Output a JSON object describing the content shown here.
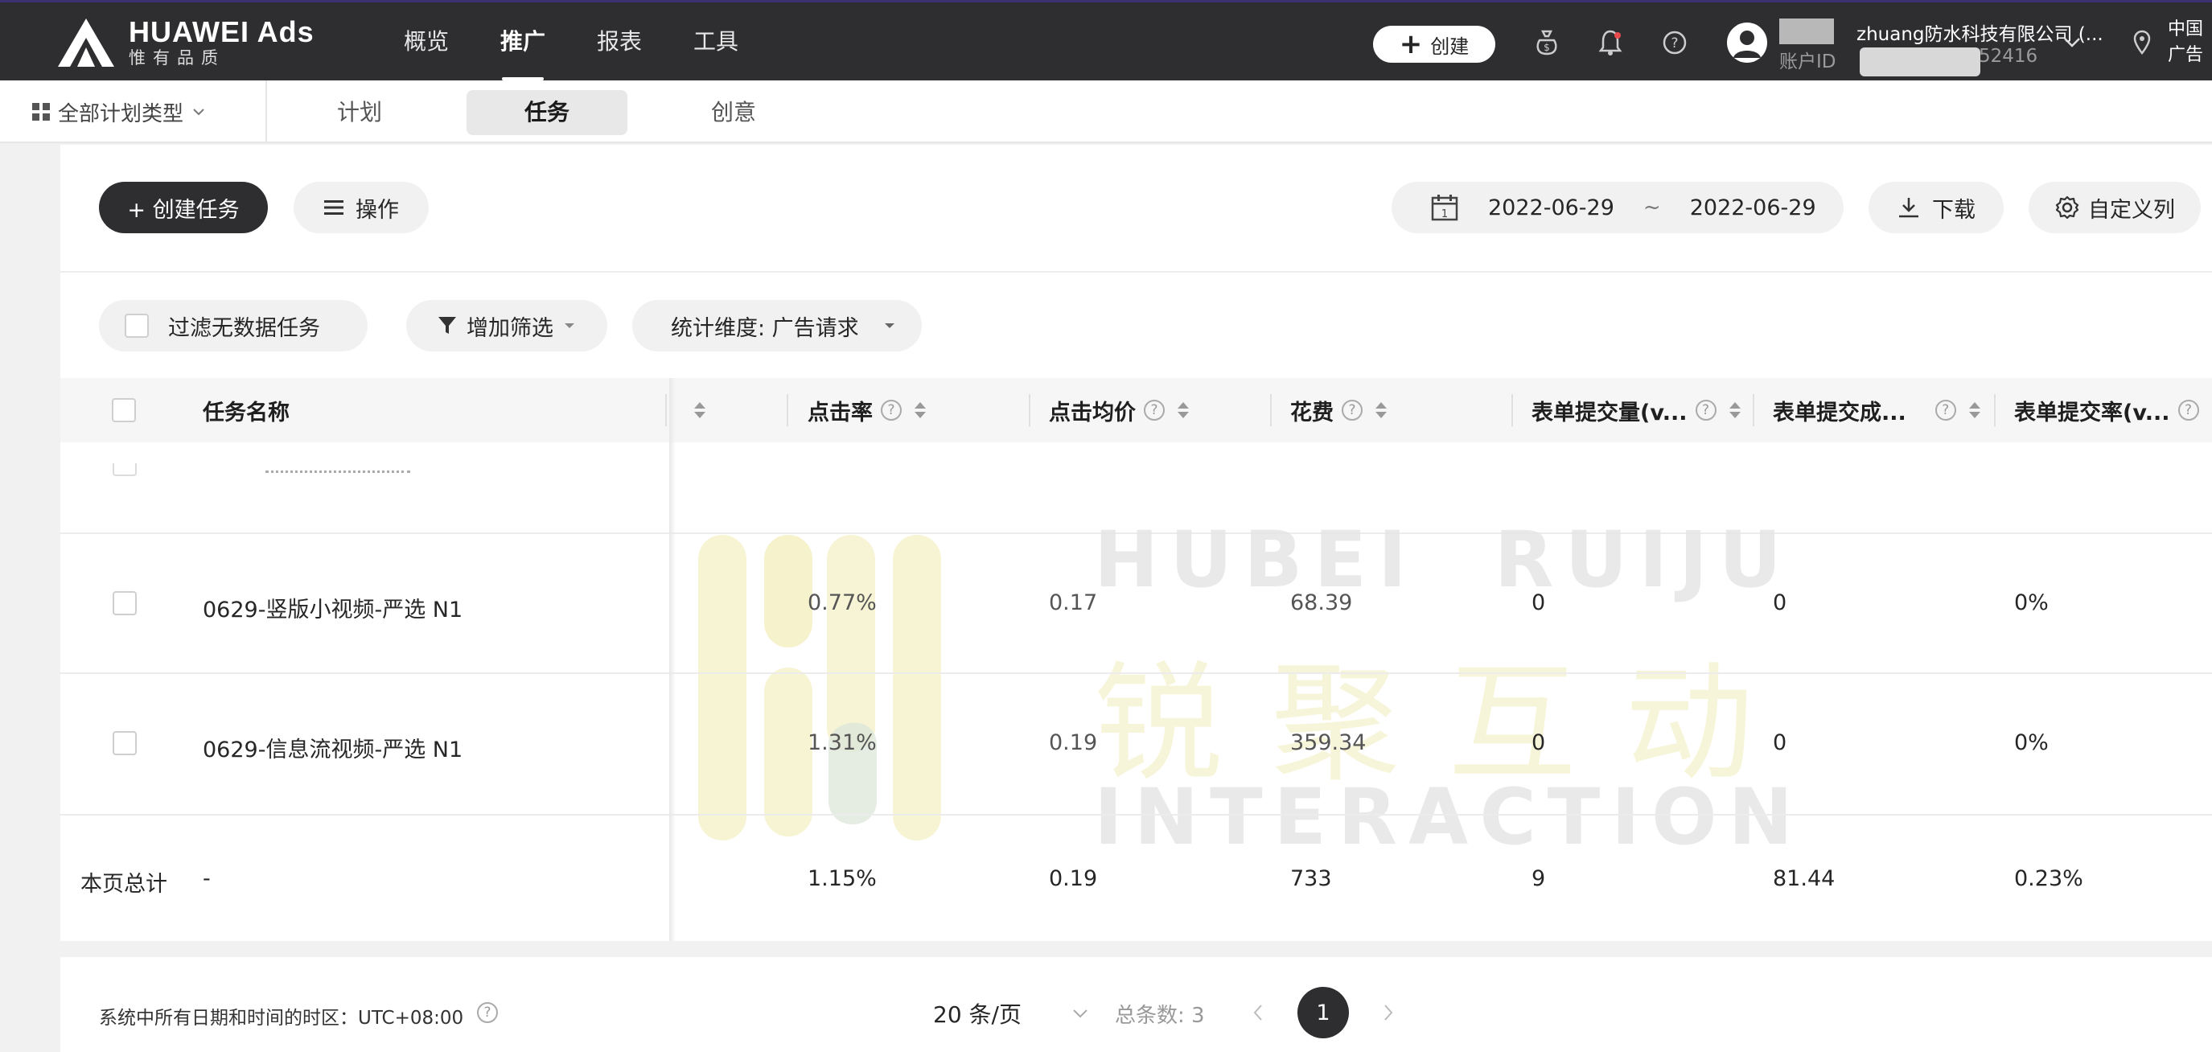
{
  "topbar": {
    "brand": "HUAWEI Ads",
    "slogan": "惟有品质",
    "nav": [
      {
        "label": "概览"
      },
      {
        "label": "推广"
      },
      {
        "label": "报表"
      },
      {
        "label": "工具"
      }
    ],
    "active_nav": "推广",
    "create_label": "创建",
    "account_name": "zhuang防水科技有限公司 (...",
    "account_id_label": "账户ID",
    "account_id_tail": "52416",
    "region_line1": "中国",
    "region_line2": "广告"
  },
  "subnav": {
    "plan_type": "全部计划类型",
    "tabs": [
      {
        "label": "计划"
      },
      {
        "label": "任务"
      },
      {
        "label": "创意"
      }
    ],
    "active_tab": "任务"
  },
  "toolbar": {
    "create_task": "+ 创建任务",
    "operate": "操作",
    "date_start": "2022-06-29",
    "date_sep": "~",
    "date_end": "2022-06-29",
    "download": "下载",
    "custom_columns": "自定义列"
  },
  "filters": {
    "filter_no_data": "过滤无数据任务",
    "add_filter": "增加筛选",
    "dimension": "统计维度: 广告请求"
  },
  "table": {
    "headers": {
      "task_name": "任务名称",
      "ctr": "点击率",
      "cpc": "点击均价",
      "cost": "花费",
      "form_submits": "表单提交量(v...",
      "form_cost": "表单提交成...",
      "form_rate": "表单提交率(v..."
    },
    "rows": [
      {
        "name": "0629-竖版小视频-严选 N1",
        "ctr": "0.77%",
        "cpc": "0.17",
        "cost": "68.39",
        "form_submits": "0",
        "form_cost": "0",
        "form_rate": "0%"
      },
      {
        "name": "0629-信息流视频-严选 N1",
        "ctr": "1.31%",
        "cpc": "0.19",
        "cost": "359.34",
        "form_submits": "0",
        "form_cost": "0",
        "form_rate": "0%"
      }
    ],
    "summary": {
      "label": "本页总计",
      "name": "-",
      "ctr": "1.15%",
      "cpc": "0.19",
      "cost": "733",
      "form_submits": "9",
      "form_cost": "81.44",
      "form_rate": "0.23%"
    }
  },
  "watermark": {
    "line1": "HUBEI  RUIJU",
    "line2": "锐聚互动",
    "line3": "INTERACTION"
  },
  "footer": {
    "timezone": "系统中所有日期和时间的时区：UTC+08:00",
    "page_size": "20 条/页",
    "total": "总条数: 3",
    "current_page": "1"
  },
  "colors": {
    "topbar_bg": "#2e2e31",
    "primary_dark": "#2e2e31",
    "watermark_yellow": "#f3efbf",
    "watermark_green": "#dfe5d2"
  }
}
